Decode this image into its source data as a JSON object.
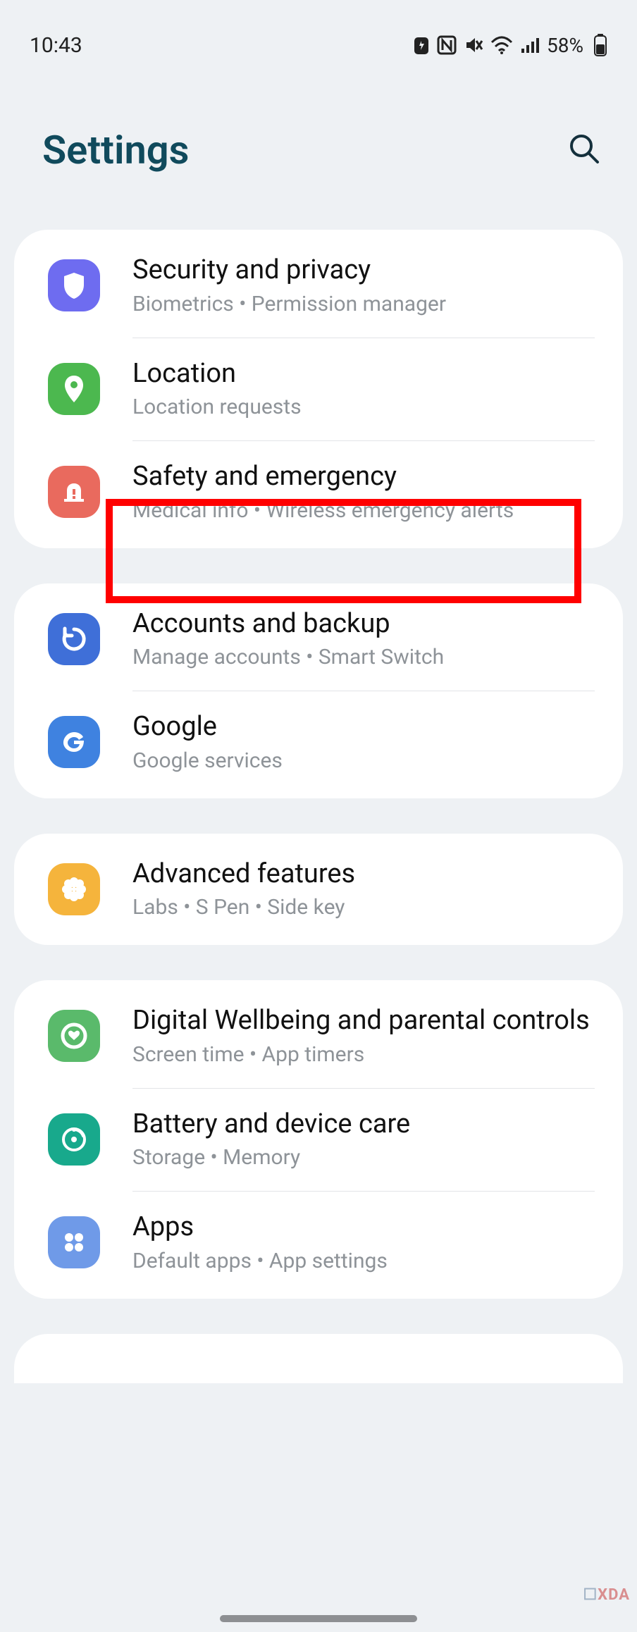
{
  "status": {
    "time": "10:43",
    "battery": "58%"
  },
  "header": {
    "title": "Settings"
  },
  "groups": [
    {
      "items": [
        {
          "title": "Security and privacy",
          "sub": "Biometrics  •  Permission manager"
        },
        {
          "title": "Location",
          "sub": "Location requests"
        },
        {
          "title": "Safety and emergency",
          "sub": "Medical info  •  Wireless emergency alerts"
        }
      ]
    },
    {
      "items": [
        {
          "title": "Accounts and backup",
          "sub": "Manage accounts  •  Smart Switch"
        },
        {
          "title": "Google",
          "sub": "Google services"
        }
      ]
    },
    {
      "items": [
        {
          "title": "Advanced features",
          "sub": "Labs  •  S Pen  •  Side key"
        }
      ]
    },
    {
      "items": [
        {
          "title": "Digital Wellbeing and parental controls",
          "sub": "Screen time  •  App timers"
        },
        {
          "title": "Battery and device care",
          "sub": "Storage  •  Memory"
        },
        {
          "title": "Apps",
          "sub": "Default apps  •  App settings"
        }
      ]
    }
  ],
  "watermark": "XDA"
}
